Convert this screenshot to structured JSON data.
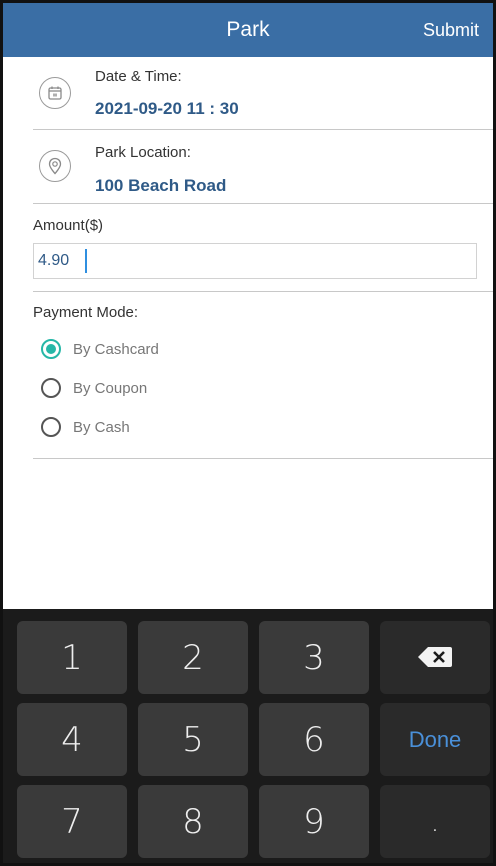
{
  "header": {
    "title": "Park",
    "submit_label": "Submit"
  },
  "datetime": {
    "label": "Date & Time:",
    "value": "2021-09-20 11 : 30",
    "icon": "calendar-icon"
  },
  "location": {
    "label": "Park Location:",
    "value": "100 Beach Road",
    "icon": "location-pin-icon"
  },
  "amount": {
    "label": "Amount($)",
    "value": "4.90"
  },
  "payment": {
    "label": "Payment Mode:",
    "options": [
      {
        "label": "By Cashcard",
        "selected": true
      },
      {
        "label": "By Coupon",
        "selected": false
      },
      {
        "label": "By Cash",
        "selected": false
      }
    ]
  },
  "keyboard": {
    "keys": [
      "1",
      "2",
      "3",
      "4",
      "5",
      "6",
      "7",
      "8",
      "9"
    ],
    "done_label": "Done",
    "dot_label": ".",
    "backspace_icon": "backspace-icon"
  },
  "colors": {
    "header_bg": "#3a6ea5",
    "value_text": "#2f5a87",
    "radio_selected": "#26b7a7",
    "done_text": "#4a90d9"
  }
}
